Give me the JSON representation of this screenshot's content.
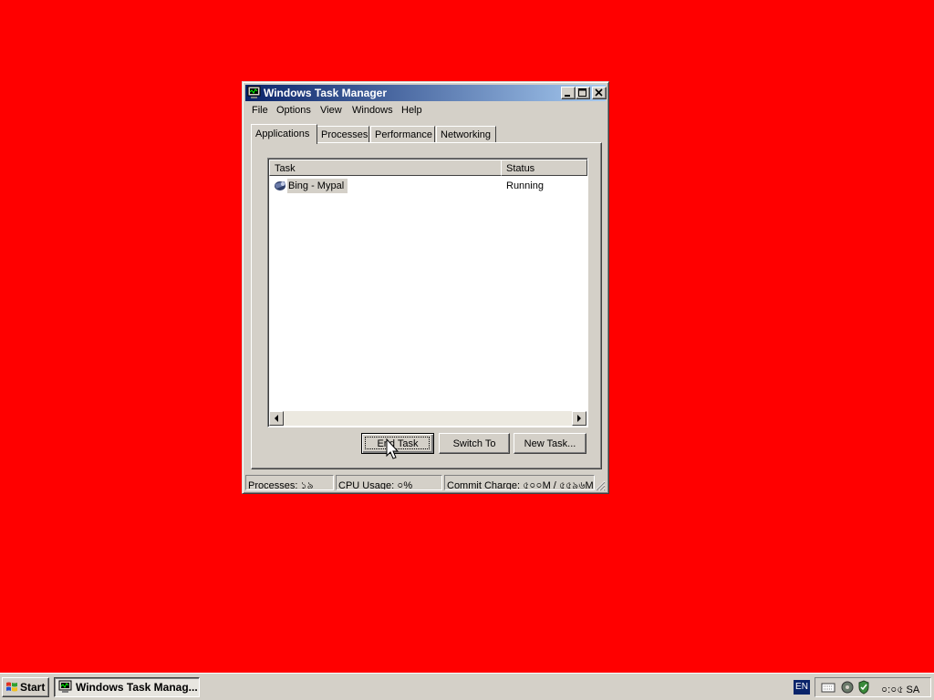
{
  "window": {
    "title": "Windows Task Manager",
    "menu": [
      "File",
      "Options",
      "View",
      "Windows",
      "Help"
    ],
    "tabs": [
      "Applications",
      "Processes",
      "Performance",
      "Networking"
    ],
    "active_tab": "Applications",
    "columns": [
      "Task",
      "Status"
    ],
    "tasks": [
      {
        "name": "Bing - Mypal",
        "status": "Running"
      }
    ],
    "buttons": {
      "end_task": "End Task",
      "switch_to": "Switch To",
      "new_task": "New Task..."
    },
    "status": {
      "processes": "Processes: ১৯",
      "cpu": "CPU Usage: ০%",
      "commit": "Commit Charge: ৫০০M / ৫৫৯৬M"
    }
  },
  "taskbar": {
    "start_label": "Start",
    "task_label": "Windows Task Manag...",
    "language": "EN",
    "clock": "০:০৫ SA"
  }
}
